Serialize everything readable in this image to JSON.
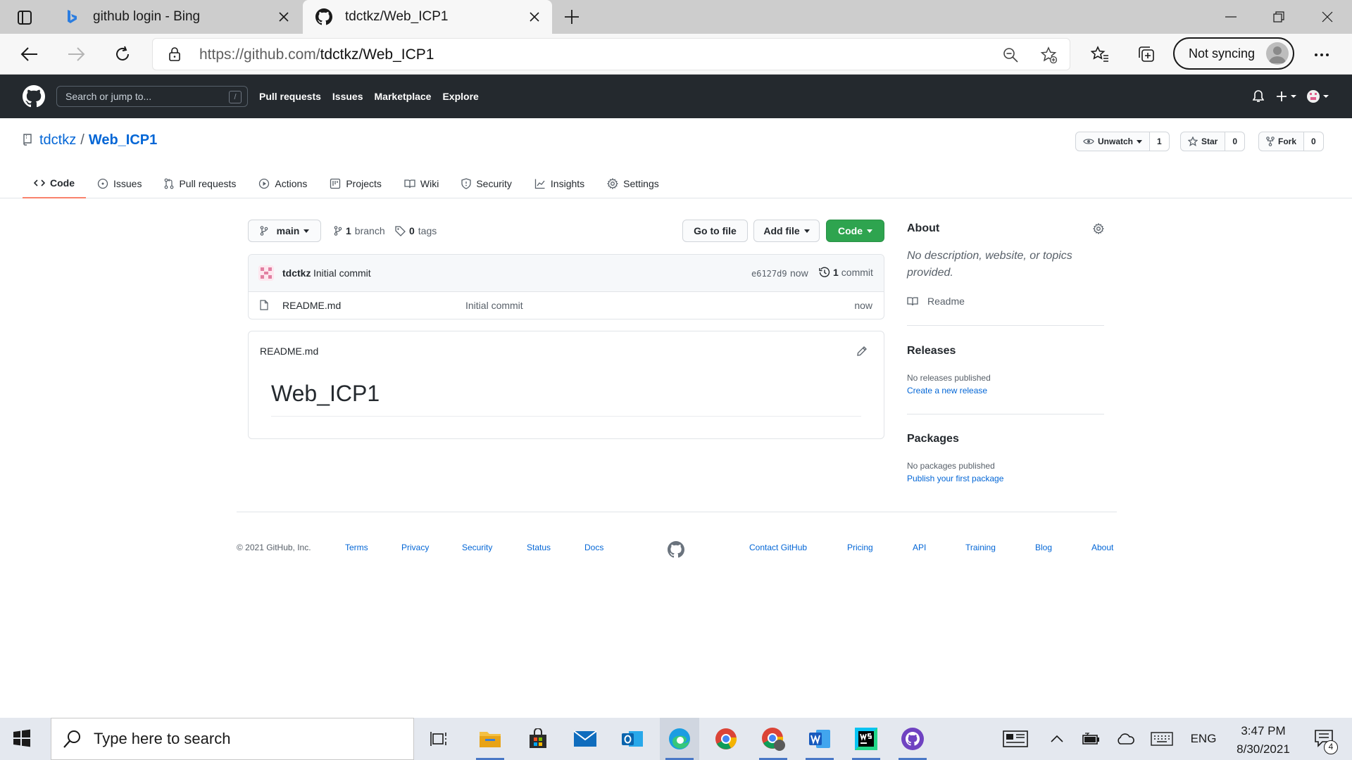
{
  "browser": {
    "tabs": [
      {
        "title": "github login - Bing",
        "favicon": "bing-icon",
        "active": false
      },
      {
        "title": "tdctkz/Web_ICP1",
        "favicon": "github-icon",
        "active": true
      }
    ],
    "url_prefix": "https://github.com/",
    "url_path": "tdctkz/Web_ICP1",
    "sync_label": "Not syncing"
  },
  "github": {
    "search_placeholder": "Search or jump to...",
    "search_shortcut": "/",
    "nav": [
      "Pull requests",
      "Issues",
      "Marketplace",
      "Explore"
    ]
  },
  "repo": {
    "owner": "tdctkz",
    "separator": "/",
    "name": "Web_ICP1",
    "watch_label": "Unwatch",
    "watch_count": "1",
    "star_label": "Star",
    "star_count": "0",
    "fork_label": "Fork",
    "fork_count": "0",
    "tabs": [
      {
        "label": "Code",
        "icon": "code-icon",
        "active": true
      },
      {
        "label": "Issues",
        "icon": "issue-icon"
      },
      {
        "label": "Pull requests",
        "icon": "pull-request-icon"
      },
      {
        "label": "Actions",
        "icon": "play-icon"
      },
      {
        "label": "Projects",
        "icon": "project-icon"
      },
      {
        "label": "Wiki",
        "icon": "book-icon"
      },
      {
        "label": "Security",
        "icon": "shield-icon"
      },
      {
        "label": "Insights",
        "icon": "graph-icon"
      },
      {
        "label": "Settings",
        "icon": "gear-icon"
      }
    ]
  },
  "code": {
    "branch": "main",
    "branch_count": "1",
    "branch_label": "branch",
    "tag_count": "0",
    "tag_label": "tags",
    "go_to_file": "Go to file",
    "add_file": "Add file",
    "code_button": "Code",
    "latest_commit": {
      "author": "tdctkz",
      "message": "Initial commit",
      "sha": "e6127d9",
      "age": "now",
      "commit_count": "1",
      "commit_label": "commit"
    },
    "files": [
      {
        "name": "README.md",
        "message": "Initial commit",
        "age": "now"
      }
    ],
    "readme": {
      "filename": "README.md",
      "heading": "Web_ICP1"
    }
  },
  "sidebar": {
    "about_title": "About",
    "about_description": "No description, website, or topics provided.",
    "readme_link": "Readme",
    "releases_title": "Releases",
    "releases_empty": "No releases published",
    "releases_link": "Create a new release",
    "packages_title": "Packages",
    "packages_empty": "No packages published",
    "packages_link": "Publish your first package"
  },
  "footer": {
    "copyright": "© 2021 GitHub, Inc.",
    "left_links": [
      "Terms",
      "Privacy",
      "Security",
      "Status",
      "Docs"
    ],
    "right_links": [
      "Contact GitHub",
      "Pricing",
      "API",
      "Training",
      "Blog",
      "About"
    ]
  },
  "taskbar": {
    "search_placeholder": "Type here to search",
    "language": "ENG",
    "time": "3:47 PM",
    "date": "8/30/2021",
    "notification_count": "4"
  },
  "colors": {
    "github_header": "#24292e",
    "link": "#0366d6",
    "code_button": "#2ea44f",
    "active_tab_underline": "#f9826c"
  }
}
